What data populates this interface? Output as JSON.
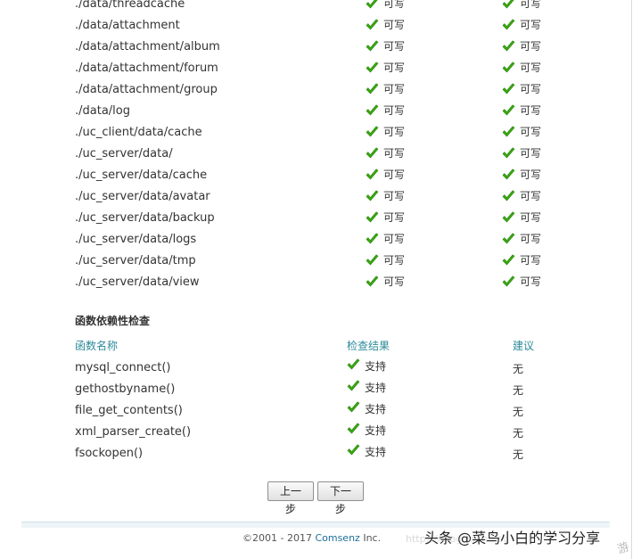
{
  "colors": {
    "check": "#3aa713",
    "header": "#2e8b9a",
    "brand": "#1d6f99"
  },
  "directories": [
    {
      "path": "./data/threadcache",
      "current": "可写",
      "required": "可写"
    },
    {
      "path": "./data/attachment",
      "current": "可写",
      "required": "可写"
    },
    {
      "path": "./data/attachment/album",
      "current": "可写",
      "required": "可写"
    },
    {
      "path": "./data/attachment/forum",
      "current": "可写",
      "required": "可写"
    },
    {
      "path": "./data/attachment/group",
      "current": "可写",
      "required": "可写"
    },
    {
      "path": "./data/log",
      "current": "可写",
      "required": "可写"
    },
    {
      "path": "./uc_client/data/cache",
      "current": "可写",
      "required": "可写"
    },
    {
      "path": "./uc_server/data/",
      "current": "可写",
      "required": "可写"
    },
    {
      "path": "./uc_server/data/cache",
      "current": "可写",
      "required": "可写"
    },
    {
      "path": "./uc_server/data/avatar",
      "current": "可写",
      "required": "可写"
    },
    {
      "path": "./uc_server/data/backup",
      "current": "可写",
      "required": "可写"
    },
    {
      "path": "./uc_server/data/logs",
      "current": "可写",
      "required": "可写"
    },
    {
      "path": "./uc_server/data/tmp",
      "current": "可写",
      "required": "可写"
    },
    {
      "path": "./uc_server/data/view",
      "current": "可写",
      "required": "可写"
    }
  ],
  "functions_section": {
    "title": "函数依赖性检查",
    "headers": {
      "name": "函数名称",
      "result": "检查结果",
      "suggestion": "建议"
    },
    "rows": [
      {
        "name": "mysql_connect()",
        "result": "支持",
        "suggestion": "无"
      },
      {
        "name": "gethostbyname()",
        "result": "支持",
        "suggestion": "无"
      },
      {
        "name": "file_get_contents()",
        "result": "支持",
        "suggestion": "无"
      },
      {
        "name": "xml_parser_create()",
        "result": "支持",
        "suggestion": "无"
      },
      {
        "name": "fsockopen()",
        "result": "支持",
        "suggestion": "无"
      }
    ]
  },
  "buttons": {
    "prev": "上一步",
    "next": "下一步"
  },
  "footer": {
    "copyright": "©2001 - 2017",
    "brand": "Comsenz",
    "suffix": "Inc."
  },
  "watermark": {
    "url": "https://blog.csdn.net",
    "text": "头条 @菜鸟小白的学习分享",
    "corner": "游"
  }
}
